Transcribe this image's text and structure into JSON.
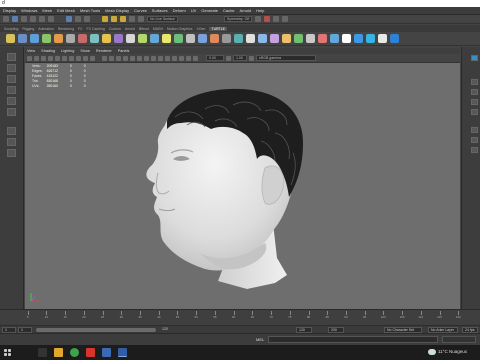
{
  "titlebar": {
    "title": "d"
  },
  "menubar": {
    "items": [
      "Display",
      "Windows",
      "Mesh",
      "Edit Mesh",
      "Mesh Tools",
      "Mesh Display",
      "Curves",
      "Surfaces",
      "Deform",
      "UV",
      "Generate",
      "Cache",
      "Arnold",
      "Help"
    ]
  },
  "statusline": {
    "surface_field": "No Live Surface",
    "symmetry_field": "Symmetry: Off"
  },
  "shelf_tabs": [
    "Sculpting",
    "Rigging",
    "Animation",
    "Rendering",
    "FX",
    "FX Caching",
    "Custom",
    "Arnold",
    "Bifrost",
    "MASH",
    "Motion Graphics",
    "XGen",
    "TURTLE"
  ],
  "viewport": {
    "menu": [
      "View",
      "Shading",
      "Lighting",
      "Show",
      "Renderer",
      "Panels"
    ],
    "toolbar": {
      "gamma_value": "0.00",
      "exposure_value": "1.00",
      "color_space": "sRGB gamma"
    },
    "hud": {
      "rows": [
        {
          "label": "Verts:",
          "values": [
            "209183",
            "0",
            "0"
          ]
        },
        {
          "label": "Edges:",
          "values": [
            "626712",
            "0",
            "0"
          ]
        },
        {
          "label": "Faces:",
          "values": [
            "415122",
            "0",
            "0"
          ]
        },
        {
          "label": "Tris:",
          "values": [
            "830168",
            "0",
            "0"
          ]
        },
        {
          "label": "UVs:",
          "values": [
            "280160",
            "0",
            "0"
          ]
        }
      ]
    }
  },
  "timeline": {
    "ticks": [
      "5",
      "10",
      "15",
      "20",
      "25",
      "30",
      "35",
      "40",
      "45",
      "50",
      "55",
      "60",
      "65",
      "70",
      "75",
      "80",
      "85",
      "90",
      "95",
      "100",
      "105",
      "110",
      "115",
      "120"
    ]
  },
  "range": {
    "start_field": "1",
    "current_field": "1",
    "end_field": "120",
    "anim_end": "120",
    "max_field": "200",
    "character_set": "No Character Set",
    "anim_layer": "No Anim Layer",
    "fps": "24 fps"
  },
  "cmdline": {
    "label": "MEL"
  },
  "taskbar": {
    "weather": "11°C  Nuageux",
    "weather_icon": "cloud-icon"
  }
}
